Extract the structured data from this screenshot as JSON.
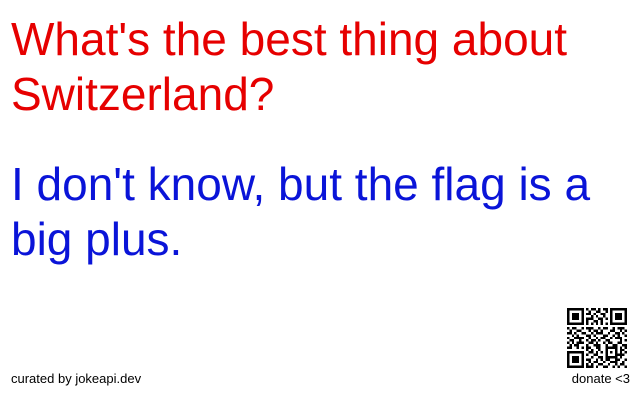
{
  "joke": {
    "setup": "What's the best thing about Switzerland?",
    "delivery": "I don't know, but the flag is a big plus."
  },
  "footer": {
    "credit": "curated by jokeapi.dev",
    "donate": "donate <3"
  },
  "colors": {
    "setup": "#e60000",
    "delivery": "#0a14d8",
    "background": "#ffffff"
  },
  "icons": {
    "qr": "qr-code-icon"
  }
}
